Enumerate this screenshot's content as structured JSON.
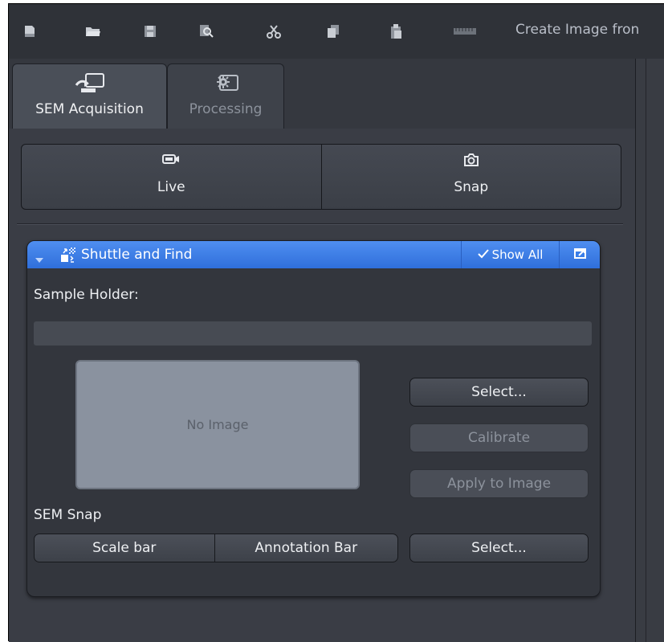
{
  "toolbar": {
    "icons": [
      "new-document-icon",
      "open-folder-icon",
      "save-icon",
      "zoom-search-icon",
      "cut-icon",
      "copy-icon",
      "paste-icon",
      "ruler-icon"
    ],
    "create_image_text": "Create Image fron"
  },
  "tabs": [
    {
      "label": "SEM Acquisition",
      "icon": "sem-acquisition-icon",
      "active": true
    },
    {
      "label": "Processing",
      "icon": "processing-gear-icon",
      "active": false
    }
  ],
  "acquire": {
    "live_label": "Live",
    "snap_label": "Snap"
  },
  "shuttle_panel": {
    "title": "Shuttle and Find",
    "show_all_label": "Show All",
    "sample_holder_label": "Sample Holder:",
    "sample_holder_value": "",
    "no_image_text": "No Image",
    "select_label": "Select...",
    "calibrate_label": "Calibrate",
    "apply_label": "Apply to Image",
    "sem_snap_label": "SEM Snap",
    "scale_bar_label": "Scale bar",
    "annotation_bar_label": "Annotation Bar",
    "snap_select_label": "Select..."
  },
  "colors": {
    "accent_blue": "#3b7ee8",
    "panel_bg": "#3a3d45",
    "image_placeholder": "#8a929f"
  }
}
